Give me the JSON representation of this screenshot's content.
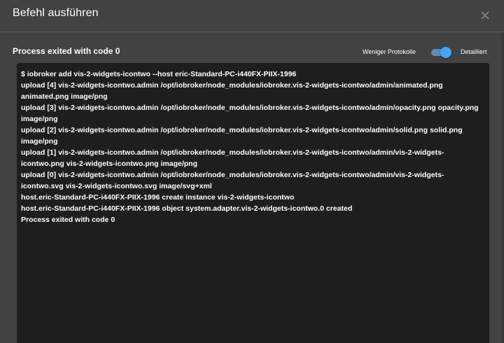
{
  "dialog": {
    "title": "Befehl ausführen",
    "close_icon": "close-icon"
  },
  "status": {
    "text": "Process exited with code 0"
  },
  "toggle": {
    "less_label": "Weniger Protokolle",
    "detail_label": "Detailliert",
    "state": "detailed",
    "color": "#42a5f5"
  },
  "log": {
    "lines": [
      "$ iobroker add vis-2-widgets-icontwo --host eric-Standard-PC-i440FX-PIIX-1996",
      "upload [4] vis-2-widgets-icontwo.admin /opt/iobroker/node_modules/iobroker.vis-2-widgets-icontwo/admin/animated.png animated.png image/png",
      "upload [3] vis-2-widgets-icontwo.admin /opt/iobroker/node_modules/iobroker.vis-2-widgets-icontwo/admin/opacity.png opacity.png image/png",
      "upload [2] vis-2-widgets-icontwo.admin /opt/iobroker/node_modules/iobroker.vis-2-widgets-icontwo/admin/solid.png solid.png image/png",
      "upload [1] vis-2-widgets-icontwo.admin /opt/iobroker/node_modules/iobroker.vis-2-widgets-icontwo/admin/vis-2-widgets-icontwo.png vis-2-widgets-icontwo.png image/png",
      "upload [0] vis-2-widgets-icontwo.admin /opt/iobroker/node_modules/iobroker.vis-2-widgets-icontwo/admin/vis-2-widgets-icontwo.svg vis-2-widgets-icontwo.svg image/svg+xml",
      "host.eric-Standard-PC-i440FX-PIIX-1996 create instance vis-2-widgets-icontwo",
      "host.eric-Standard-PC-i440FX-PIIX-1996 object system.adapter.vis-2-widgets-icontwo.0 created",
      "Process exited with code 0"
    ]
  }
}
